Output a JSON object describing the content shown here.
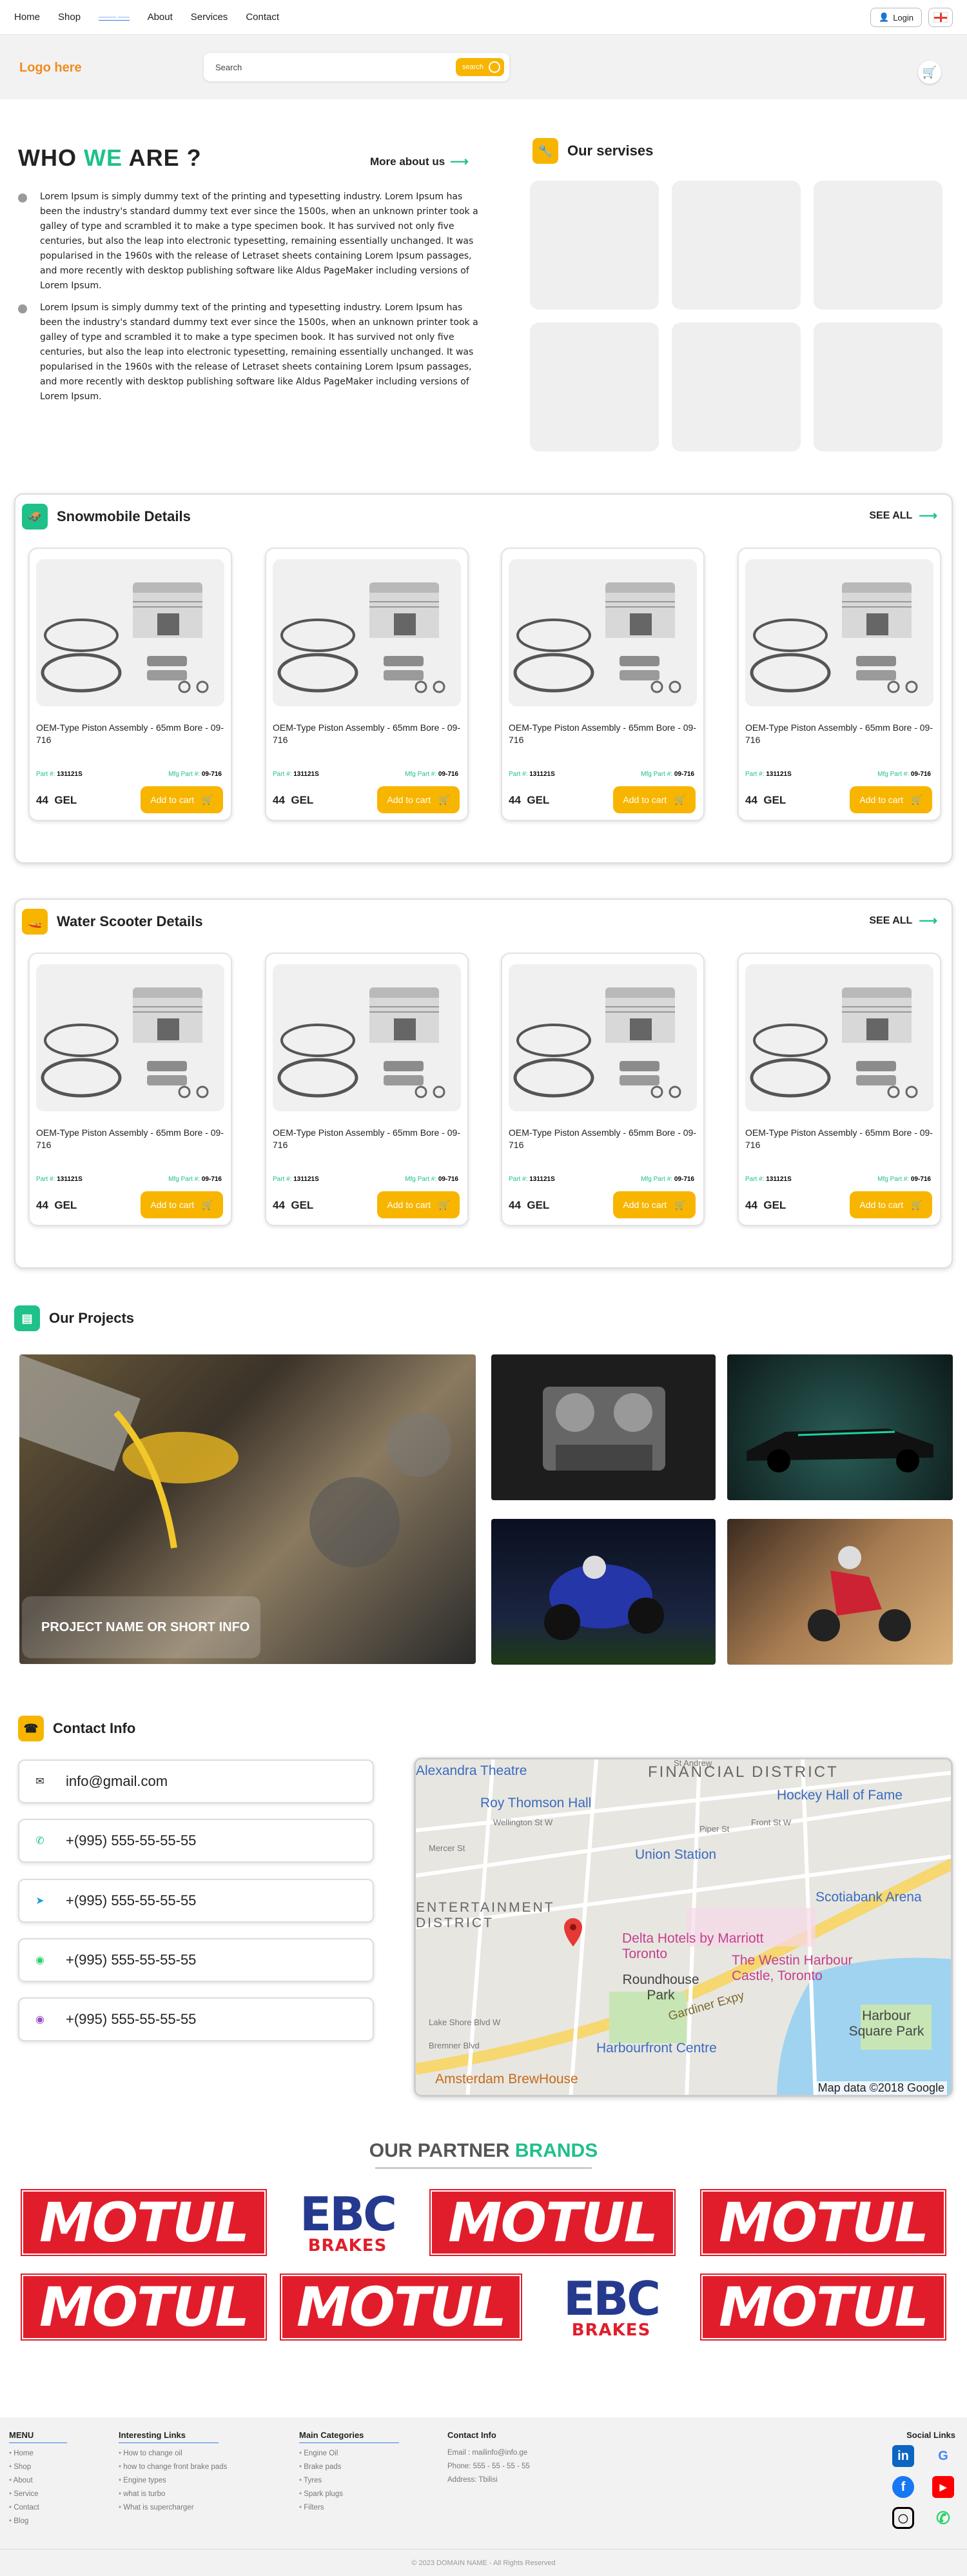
{
  "nav": {
    "links": [
      "Home",
      "Shop",
      "About",
      "Services",
      "Contact"
    ],
    "active_indicator": "——— ——",
    "login": "Login"
  },
  "header": {
    "logo": "Logo here",
    "search_placeholder": "Search",
    "search_button": "search"
  },
  "about": {
    "title_a": "WHO ",
    "title_we": "WE",
    "title_b": " ARE ?",
    "more": "More about us",
    "para1": "Lorem Ipsum is simply dummy text of the printing and typesetting industry. Lorem Ipsum has been the industry's standard dummy text ever since the 1500s, when an unknown printer took a galley of type and scrambled it to make a type specimen book. It has survived not only five centuries, but also the leap into electronic typesetting, remaining essentially unchanged. It was popularised in the 1960s with the release of Letraset sheets containing Lorem Ipsum passages, and more recently with desktop publishing software like Aldus PageMaker including versions of Lorem Ipsum.",
    "para2": "Lorem Ipsum is simply dummy text of the printing and typesetting industry. Lorem Ipsum has been the industry's standard dummy text ever since the 1500s, when an unknown printer took a galley of type and scrambled it to make a type specimen book. It has survived not only five centuries, but also the leap into electronic typesetting, remaining essentially unchanged. It was popularised in the 1960s with the release of Letraset sheets containing Lorem Ipsum passages, and more recently with desktop publishing software like Aldus PageMaker including versions of Lorem Ipsum."
  },
  "services": {
    "title": "Our servises"
  },
  "product": {
    "name": "OEM-Type Piston Assembly - 65mm Bore - 09-716",
    "part_label": "Part #:",
    "part": "131121S",
    "mfg_label": "Mfg Part #:",
    "mfg": "09-716",
    "price": "44",
    "currency": "GEL",
    "add": "Add to cart"
  },
  "snow": {
    "title": "Snowmobile Details",
    "see_all": "SEE ALL"
  },
  "water": {
    "title": "Water Scooter Details",
    "see_all": "SEE ALL"
  },
  "projects": {
    "title": "Our Projects",
    "banner": "PROJECT NAME OR SHORT INFO"
  },
  "contact": {
    "title": "Contact Info",
    "email": "info@gmail.com",
    "phone": "+(995) 555-55-55-55"
  },
  "map": {
    "labels": [
      "Alexandra Theatre",
      "FINANCIAL DISTRICT",
      "Roy Thomson Hall",
      "Hockey Hall of Fame",
      "Union Station",
      "Scotiabank Arena",
      "ENTERTAINMENT DISTRICT",
      "Delta Hotels by Marriott Toronto",
      "The Westin Harbour Castle, Toronto",
      "Roundhouse Park",
      "Harbour Square Park",
      "Harbourfront Centre",
      "Gardiner Expy",
      "Amsterdam BrewHouse",
      "Map data ©2018 Google",
      "Wellington St W",
      "Front St W",
      "Piper St",
      "Mercer St",
      "Lake Shore Blvd W",
      "Bremner Blvd",
      "St Andrew"
    ]
  },
  "partners": {
    "title_a": "OUR PARTNER ",
    "title_b": "BRANDS",
    "motul": "MOTUL",
    "ebc": "EBC",
    "brakes": "BRAKES"
  },
  "footer": {
    "menu_title": "MENU",
    "menu": [
      "Home",
      "Shop",
      "About",
      "Service",
      "Contact",
      "Blog"
    ],
    "links_title": "Interesting Links",
    "links": [
      "How to change oil",
      "how to change front brake pads",
      "Engine types",
      "what is turbo",
      "What is supercharger"
    ],
    "cat_title": "Main Categories",
    "cats": [
      "Engine Oil",
      "Brake pads",
      "Tyres",
      "Spark plugs",
      "Filters"
    ],
    "contact_title": "Contact Info",
    "email": "Email : mailinfo@info.ge",
    "phone": "Phone: 555 - 55 - 55 - 55",
    "address": "Address: Tbilisi",
    "social_title": "Social Links",
    "copyright": "© 2023 DOMAIN NAME - All Rights Reserved"
  },
  "colors": {
    "accent_green": "#1fc189",
    "accent_yellow": "#f7b500",
    "logo_orange": "#f08c1c",
    "motul_red": "#e21d2b",
    "ebc_blue": "#253a8f"
  }
}
